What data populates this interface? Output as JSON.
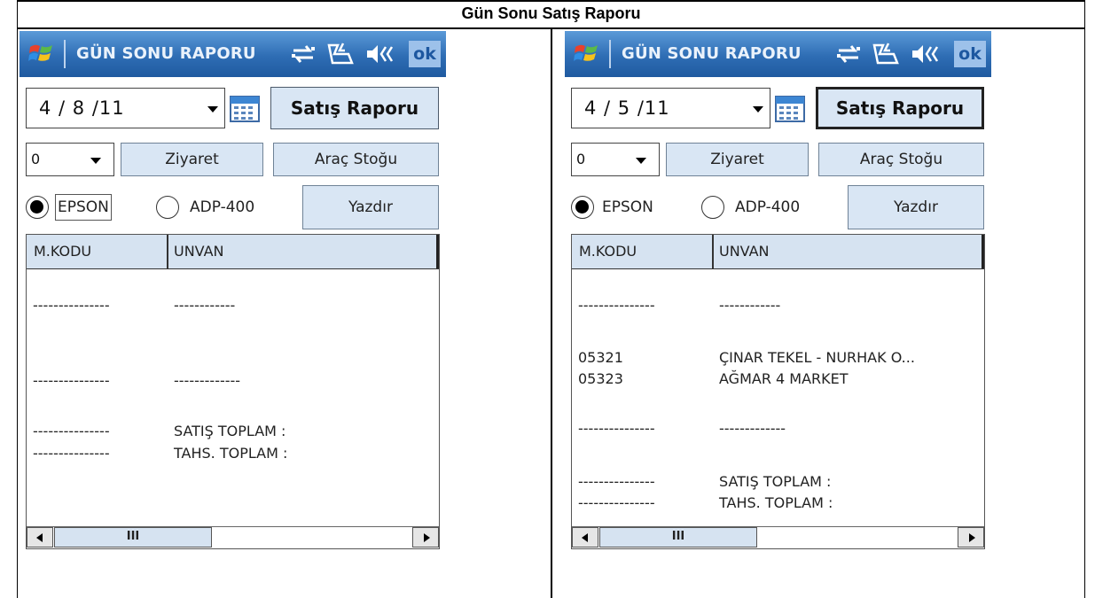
{
  "document": {
    "title": "Gün Sonu Satış Raporu"
  },
  "colors": {
    "titlebar": "#2e6db4",
    "button_face": "#d9e6f4",
    "list_header": "#d6e3f1",
    "ok_button": "#9dc1ea"
  },
  "icons": [
    "windows-start-icon",
    "connectivity-icon",
    "phone-signal-icon",
    "speaker-volume-icon",
    "calendar-icon",
    "chevron-down-icon",
    "scroll-left-icon",
    "scroll-right-icon"
  ],
  "screens": [
    {
      "titlebar": {
        "title": "GÜN SONU RAPORU",
        "ok_label": "ok"
      },
      "date": "4 / 8 /11",
      "report_button": "Satış Raporu",
      "number_select": "0",
      "visit_button": "Ziyaret",
      "stock_button": "Araç Stoğu",
      "radio_epson": "EPSON",
      "radio_adp": "ADP-400",
      "print_button": "Yazdır",
      "columns": [
        "M.KODU",
        "UNVAN"
      ],
      "rows": [
        [
          "---------------",
          "------------"
        ],
        [
          "",
          ""
        ],
        [
          "",
          ""
        ],
        [
          "---------------",
          "-------------"
        ],
        [
          "",
          ""
        ],
        [
          "---------------",
          "SATIŞ TOPLAM :"
        ],
        [
          "---------------",
          "TAHS. TOPLAM :"
        ]
      ],
      "scroll_thumb": "III"
    },
    {
      "titlebar": {
        "title": "GÜN SONU RAPORU",
        "ok_label": "ok"
      },
      "date": "4 / 5 /11",
      "report_button": "Satış Raporu",
      "number_select": "0",
      "visit_button": "Ziyaret",
      "stock_button": "Araç Stoğu",
      "radio_epson": "EPSON",
      "radio_adp": "ADP-400",
      "print_button": "Yazdır",
      "columns": [
        "M.KODU",
        "UNVAN"
      ],
      "rows": [
        [
          "---------------",
          "------------"
        ],
        [
          "",
          ""
        ],
        [
          "05321",
          "ÇINAR TEKEL - NURHAK O..."
        ],
        [
          "05323",
          "AĞMAR 4 MARKET"
        ],
        [
          "",
          ""
        ],
        [
          "---------------",
          "-------------"
        ],
        [
          "",
          ""
        ],
        [
          "---------------",
          "SATIŞ TOPLAM :"
        ],
        [
          "---------------",
          "TAHS. TOPLAM :"
        ]
      ],
      "scroll_thumb": "III"
    }
  ]
}
